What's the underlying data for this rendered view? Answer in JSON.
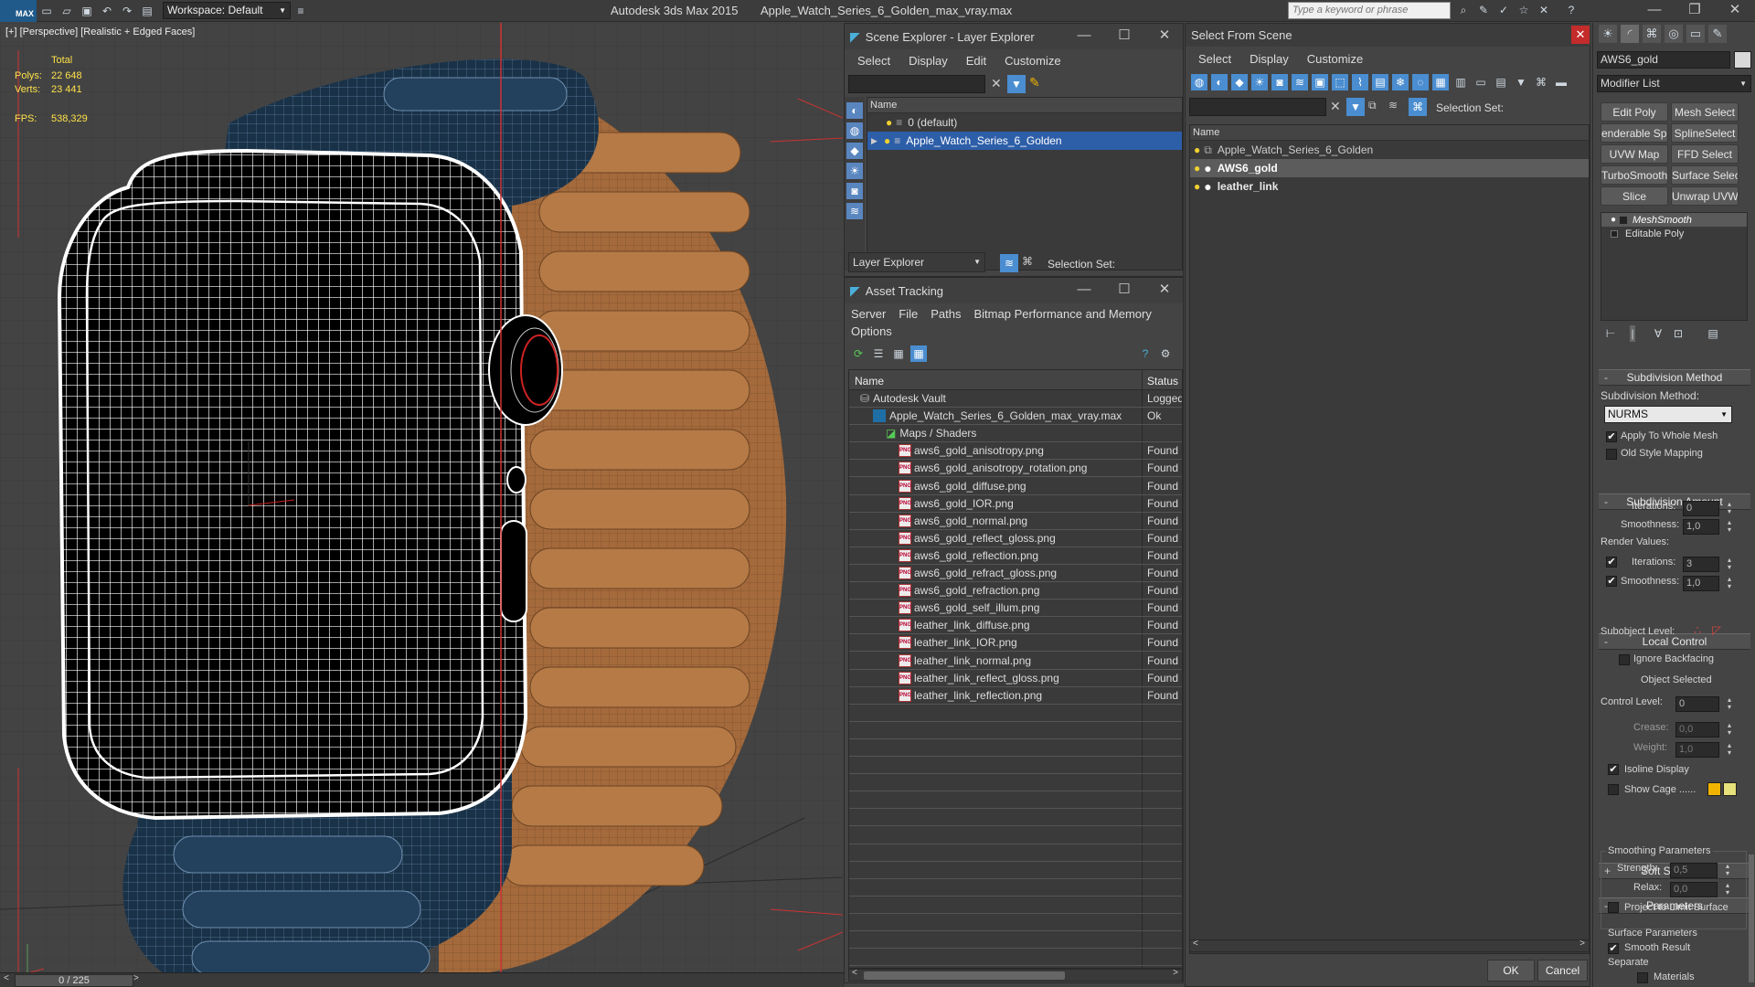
{
  "app": {
    "title": "Autodesk 3ds Max  2015",
    "filename": "Apple_Watch_Series_6_Golden_max_vray.max",
    "workspace": "Workspace: Default",
    "search_placeholder": "Type a keyword or phrase",
    "logo": "MAX"
  },
  "viewport": {
    "label": "[+] [Perspective] [Realistic + Edged Faces]",
    "stats": {
      "total_label": "Total",
      "polys_label": "Polys:",
      "polys": "22 648",
      "verts_label": "Verts:",
      "verts": "23 441",
      "fps_label": "FPS:",
      "fps": "538,329"
    }
  },
  "timeline": {
    "frame": "0 / 225"
  },
  "scene_explorer": {
    "title": "Scene Explorer - Layer Explorer",
    "menu": [
      "Select",
      "Display",
      "Edit",
      "Customize"
    ],
    "col_name": "Name",
    "layers": [
      {
        "name": "0 (default)"
      },
      {
        "name": "Apple_Watch_Series_6_Golden",
        "selected": true
      }
    ],
    "footer_dropdown": "Layer Explorer",
    "selection_set": "Selection Set:"
  },
  "asset_tracking": {
    "title": "Asset Tracking",
    "menu": [
      "Server",
      "File",
      "Paths",
      "Bitmap Performance and Memory"
    ],
    "menu2": "Options",
    "col_name": "Name",
    "col_status": "Status",
    "rows": [
      {
        "name": "Autodesk Vault",
        "status": "Logged",
        "indent": 0
      },
      {
        "name": "Apple_Watch_Series_6_Golden_max_vray.max",
        "status": "Ok",
        "indent": 1
      },
      {
        "name": "Maps / Shaders",
        "status": "",
        "indent": 2
      },
      {
        "name": "aws6_gold_anisotropy.png",
        "status": "Found",
        "indent": 3
      },
      {
        "name": "aws6_gold_anisotropy_rotation.png",
        "status": "Found",
        "indent": 3
      },
      {
        "name": "aws6_gold_diffuse.png",
        "status": "Found",
        "indent": 3
      },
      {
        "name": "aws6_gold_IOR.png",
        "status": "Found",
        "indent": 3
      },
      {
        "name": "aws6_gold_normal.png",
        "status": "Found",
        "indent": 3
      },
      {
        "name": "aws6_gold_reflect_gloss.png",
        "status": "Found",
        "indent": 3
      },
      {
        "name": "aws6_gold_reflection.png",
        "status": "Found",
        "indent": 3
      },
      {
        "name": "aws6_gold_refract_gloss.png",
        "status": "Found",
        "indent": 3
      },
      {
        "name": "aws6_gold_refraction.png",
        "status": "Found",
        "indent": 3
      },
      {
        "name": "aws6_gold_self_illum.png",
        "status": "Found",
        "indent": 3
      },
      {
        "name": "leather_link_diffuse.png",
        "status": "Found",
        "indent": 3
      },
      {
        "name": "leather_link_IOR.png",
        "status": "Found",
        "indent": 3
      },
      {
        "name": "leather_link_normal.png",
        "status": "Found",
        "indent": 3
      },
      {
        "name": "leather_link_reflect_gloss.png",
        "status": "Found",
        "indent": 3
      },
      {
        "name": "leather_link_reflection.png",
        "status": "Found",
        "indent": 3
      }
    ],
    "file_badge": "PNG"
  },
  "select_from_scene": {
    "title": "Select From Scene",
    "menu": [
      "Select",
      "Display",
      "Customize"
    ],
    "selection_set": "Selection Set:",
    "col_name": "Name",
    "items": [
      {
        "name": "Apple_Watch_Series_6_Golden",
        "bold": false
      },
      {
        "name": "AWS6_gold",
        "bold": true,
        "selected": true
      },
      {
        "name": "leather_link",
        "bold": true
      }
    ],
    "ok": "OK",
    "cancel": "Cancel"
  },
  "modify_panel": {
    "object_name": "AWS6_gold",
    "modifier_list": "Modifier List",
    "buttons": [
      [
        "Edit Poly",
        "Mesh Select"
      ],
      [
        "enderable Spli",
        "SplineSelect"
      ],
      [
        "UVW Map",
        "FFD Select"
      ],
      [
        "TurboSmooth",
        "Surface Select"
      ],
      [
        "Slice",
        "Unwrap UVW"
      ]
    ],
    "stack": [
      {
        "name": "MeshSmooth",
        "selected": true
      },
      {
        "name": "Editable Poly"
      }
    ],
    "subdivision_method": {
      "title": "Subdivision Method",
      "label": "Subdivision Method:",
      "value": "NURMS",
      "apply_whole": "Apply To Whole Mesh",
      "old_style": "Old Style Mapping"
    },
    "subdivision_amount": {
      "title": "Subdivision Amount",
      "iterations_label": "Iterations:",
      "iterations": "0",
      "smoothness_label": "Smoothness:",
      "smoothness": "1,0",
      "render_values": "Render Values:",
      "r_iterations": "3",
      "r_smoothness": "1,0"
    },
    "local_control": {
      "title": "Local Control",
      "subobject": "Subobject Level:",
      "ignore_backfacing": "Ignore Backfacing",
      "object_selected": "Object Selected",
      "control_level_label": "Control Level:",
      "control_level": "0",
      "crease_label": "Crease:",
      "crease": "0,0",
      "weight_label": "Weight:",
      "weight": "1,0",
      "isoline": "Isoline Display",
      "show_cage": "Show Cage ......"
    },
    "soft_selection": "Soft Selection",
    "parameters": {
      "title": "Parameters",
      "smoothing": "Smoothing Parameters",
      "strength_label": "Strength:",
      "strength": "0,5",
      "relax_label": "Relax:",
      "relax": "0,0",
      "project": "Project to Limit Surface",
      "surface": "Surface Parameters",
      "smooth_result": "Smooth Result",
      "separate": "Separate",
      "materials": "Materials"
    },
    "cage_colors": [
      "#f0b400",
      "#e8e07a"
    ]
  }
}
